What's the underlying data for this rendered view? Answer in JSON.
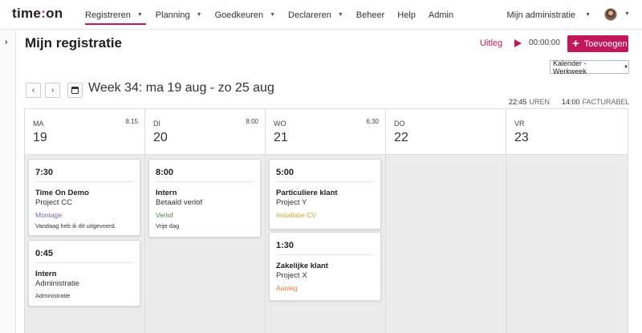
{
  "brand": {
    "name_part1": "time",
    "name_colon": ":",
    "name_part2": "on",
    "accent_color": "#c2185b"
  },
  "nav": {
    "items": [
      {
        "label": "Registreren",
        "has_dropdown": true,
        "active": true
      },
      {
        "label": "Planning",
        "has_dropdown": true
      },
      {
        "label": "Goedkeuren",
        "has_dropdown": true
      },
      {
        "label": "Declareren",
        "has_dropdown": true
      },
      {
        "label": "Beheer"
      },
      {
        "label": "Help"
      },
      {
        "label": "Admin"
      }
    ],
    "admin_menu": "Mijn administratie"
  },
  "page": {
    "title": "Mijn registratie",
    "help_link": "Uitleg",
    "timer": "00:00:00",
    "add_button": "Toevoegen",
    "view_select": "Kalender - Werkweek"
  },
  "week": {
    "title": "Week 34: ma 19 aug - zo 25 aug",
    "total_hours": "22:45",
    "total_hours_unit": "UREN",
    "billable_hours": "14:00",
    "billable_unit": "FACTURABEL"
  },
  "days": [
    {
      "name": "MA",
      "number": "19",
      "hours": "8:15",
      "entries": [
        {
          "time": "7:30",
          "client": "Time On Demo",
          "project": "Project CC",
          "activity": "Montage",
          "activity_color": "#8e5bb5",
          "note": "Vandaag heb ik dit uitgevoerd."
        },
        {
          "time": "0:45",
          "client": "Intern",
          "project": "Administratie",
          "activity": "Administratie",
          "activity_color": "#333333",
          "activity_small": true
        }
      ]
    },
    {
      "name": "DI",
      "number": "20",
      "hours": "8:00",
      "entries": [
        {
          "time": "8:00",
          "client": "Intern",
          "project": "Betaald verlof",
          "activity": "Verlof",
          "activity_color": "#4f8a4f",
          "note": "Vrije dag"
        }
      ]
    },
    {
      "name": "WO",
      "number": "21",
      "hours": "6:30",
      "entries": [
        {
          "time": "5:00",
          "client": "Particuliere klant",
          "project": "Project Y",
          "activity": "Installatie CV",
          "activity_color": "#d4a630"
        },
        {
          "time": "1:30",
          "client": "Zakelijke klant",
          "project": "Project X",
          "activity": "Aanleg",
          "activity_color": "#e07b39"
        }
      ]
    },
    {
      "name": "DO",
      "number": "22",
      "hours": "",
      "entries": []
    },
    {
      "name": "VR",
      "number": "23",
      "hours": "",
      "entries": []
    }
  ]
}
